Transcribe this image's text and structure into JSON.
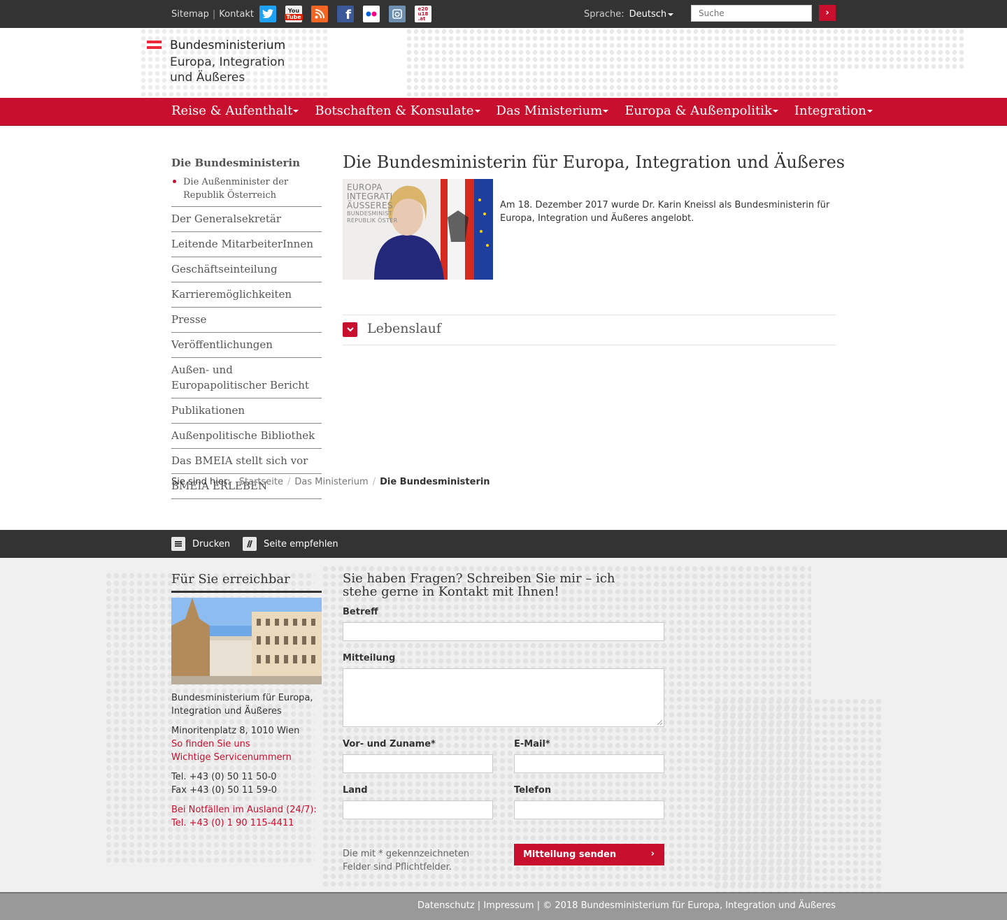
{
  "topbar": {
    "sitemap": "Sitemap",
    "separator": "|",
    "kontakt": "Kontakt",
    "social": [
      {
        "name": "twitter-icon",
        "glyph": "t",
        "color": "#1da1f2"
      },
      {
        "name": "youtube-icon",
        "glyph": "You",
        "color": "#e0e0e0"
      },
      {
        "name": "rss-icon",
        "glyph": "))",
        "color": "#f26522"
      },
      {
        "name": "facebook-icon",
        "glyph": "f",
        "color": "#3b5998"
      },
      {
        "name": "flickr-icon",
        "glyph": "●●",
        "color": "#ffffff"
      },
      {
        "name": "instagram-icon",
        "glyph": "◎",
        "color": "#517fa4"
      },
      {
        "name": "e2020-icon",
        "glyph": "e20",
        "color": "#ffffff"
      }
    ],
    "language_label": "Sprache:",
    "language_value": "Deutsch",
    "search_placeholder": "Suche",
    "search_button": "›"
  },
  "logo": {
    "line1": "Bundesministerium",
    "line2": "Europa, Integration",
    "line3": "und Äußeres"
  },
  "nav": {
    "items": [
      "Reise & Aufenthalt",
      "Botschaften & Konsulate",
      "Das Ministerium",
      "Europa & Außenpolitik",
      "Integration"
    ]
  },
  "sidebar": {
    "heading": "Die Bundesministerin",
    "sub": "Die Außenminister der Republik Österreich",
    "items": [
      "Der Generalsekretär",
      "Leitende MitarbeiterInnen",
      "Geschäftseinteilung",
      "Karrieremöglichkeiten",
      "Presse",
      "Veröffentlichungen",
      "Außen- und Europapolitischer Bericht",
      "Publikationen",
      "Außenpolitische Bibliothek",
      "Das BMEIA stellt sich vor",
      "BMEIA ERLEBEN"
    ]
  },
  "main": {
    "title": "Die Bundesministerin für Europa, Integration und Äußeres",
    "portrait_text": [
      "EUROPA",
      "INTEGRATI",
      "ÄUSSERES",
      "BUNDESMINIST",
      "REPUBLIK ÖSTER"
    ],
    "intro": "Am 18. Dezember 2017 wurde Dr. Karin Kneissl als Bundesministerin für Europa, Integration und Äußeres angelobt.",
    "accordion_title": "Lebenslauf"
  },
  "breadcrumb": {
    "label": "Sie sind hier:",
    "items": [
      "Startseite",
      "Das Ministerium"
    ],
    "current": "Die Bundesministerin",
    "separator": "/"
  },
  "tools": {
    "print": "Drucken",
    "recommend": "Seite empfehlen"
  },
  "reach": {
    "title": "Für Sie erreichbar",
    "org": "Bundesministerium für Europa, Integration und Äußeres",
    "address": "Minoritenplatz 8, 1010 Wien",
    "find": "So finden Sie uns",
    "service": "Wichtige Servicenummern",
    "tel": "Tel. +43 (0) 50 11 50-0",
    "fax": "Fax +43 (0) 50 11 59-0",
    "emergency": "Bei Notfällen im Ausland (24/7):",
    "emergency_tel": "Tel. +43 (0) 1 90 115-4411"
  },
  "form": {
    "title": "Sie haben Fragen? Schreiben Sie mir – ich stehe gerne in Kontakt mit Ihnen!",
    "subject_label": "Betreff",
    "message_label": "Mitteilung",
    "name_label": "Vor- und Zuname*",
    "email_label": "E-Mail*",
    "country_label": "Land",
    "phone_label": "Telefon",
    "hint": "Die mit * gekennzeichneten Felder sind Pflichtfelder.",
    "submit": "Mitteilung senden",
    "submit_icon": "›"
  },
  "footer": {
    "text": "Datenschutz | Impressum | © 2018 Bundesministerium für Europa, Integration und Äußeres"
  }
}
